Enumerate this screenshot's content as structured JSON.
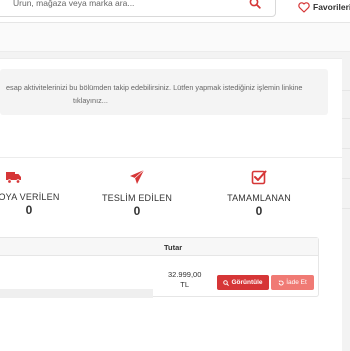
{
  "header": {
    "search_placeholder": "Ürun, mağaza veya marka ara...",
    "favorites_label": "Favorilerim"
  },
  "info": {
    "line1": "esap aktivitelerinizi bu bölümden takip edebilirsiniz. Lütfen yapmak istediğiniz işlemin linkine",
    "line2": "tıklayınız..."
  },
  "stats": [
    {
      "label": "OYA VERİLEN",
      "count": "0",
      "icon": "truck-icon"
    },
    {
      "label": "TESLİM EDİLEN",
      "count": "0",
      "icon": "paper-plane-icon"
    },
    {
      "label": "TAMAMLANAN",
      "count": "0",
      "icon": "check-square-icon"
    }
  ],
  "table": {
    "col_total": "Tutar",
    "row": {
      "amount_line1": "32.999,00",
      "amount_line2": "TL",
      "view_label": "Görüntüle",
      "return_label": "İade Et"
    }
  },
  "colors": {
    "accent": "#d63637",
    "accent_light": "#f07a74"
  }
}
